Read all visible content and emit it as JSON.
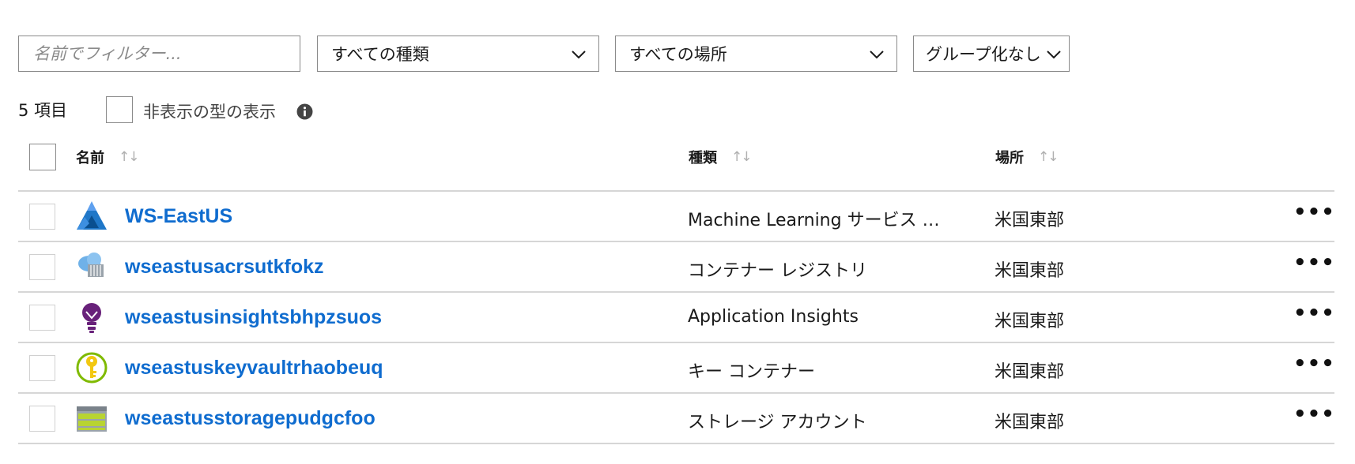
{
  "filters": {
    "name_placeholder": "名前でフィルター...",
    "type_value": "すべての種類",
    "location_value": "すべての場所",
    "grouping_value": "グループ化なし"
  },
  "summary": {
    "count_label": "5 項目",
    "show_hidden_label": "非表示の型の表示"
  },
  "columns": {
    "name": "名前",
    "type": "種類",
    "location": "場所",
    "sort_glyph": "↑↓"
  },
  "rows": [
    {
      "name": "WS-EastUS",
      "type": "Machine Learning サービス …",
      "location": "米国東部",
      "icon": "machine-learning-icon",
      "more": "•••"
    },
    {
      "name": "wseastusacrsutkfokz",
      "type": "コンテナー レジストリ",
      "location": "米国東部",
      "icon": "container-registry-icon",
      "more": "•••"
    },
    {
      "name": "wseastusinsightsbhpzsuos",
      "type": "Application Insights",
      "location": "米国東部",
      "icon": "app-insights-icon",
      "more": "•••"
    },
    {
      "name": "wseastuskeyvaultrhaobeuq",
      "type": "キー コンテナー",
      "location": "米国東部",
      "icon": "key-vault-icon",
      "more": "•••"
    },
    {
      "name": "wseastusstoragepudgcfoo",
      "type": "ストレージ アカウント",
      "location": "米国東部",
      "icon": "storage-account-icon",
      "more": "•••"
    }
  ],
  "colors": {
    "link": "#0f6ccf",
    "border": "#8a8a8a",
    "divider": "#d6d6d6"
  }
}
